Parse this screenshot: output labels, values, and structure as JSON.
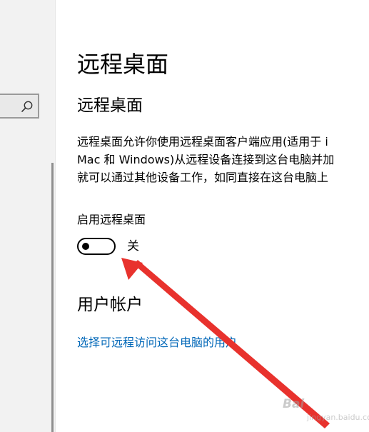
{
  "page": {
    "title": "远程桌面",
    "section_title": "远程桌面",
    "description_lines": [
      "远程桌面允许你使用远程桌面客户端应用(适用于 i",
      "Mac 和 Windows)从远程设备连接到这台电脑并加",
      "就可以通过其他设备工作，如同直接在这台电脑上"
    ],
    "toggle": {
      "label": "启用远程桌面",
      "state_text": "关",
      "is_on": false
    },
    "user_accounts": {
      "title": "用户帐户",
      "link_text": "选择可远程访问这台电脑的用户"
    }
  },
  "sidebar": {
    "search_icon": "search-icon"
  },
  "annotation": {
    "arrow_color": "#e8322d"
  },
  "watermark": {
    "brand": "Bai",
    "site": "jingyan.baidu.com"
  },
  "colors": {
    "link": "#0067b8",
    "sidebar_bg": "#f2f2f2",
    "text": "#000000"
  }
}
